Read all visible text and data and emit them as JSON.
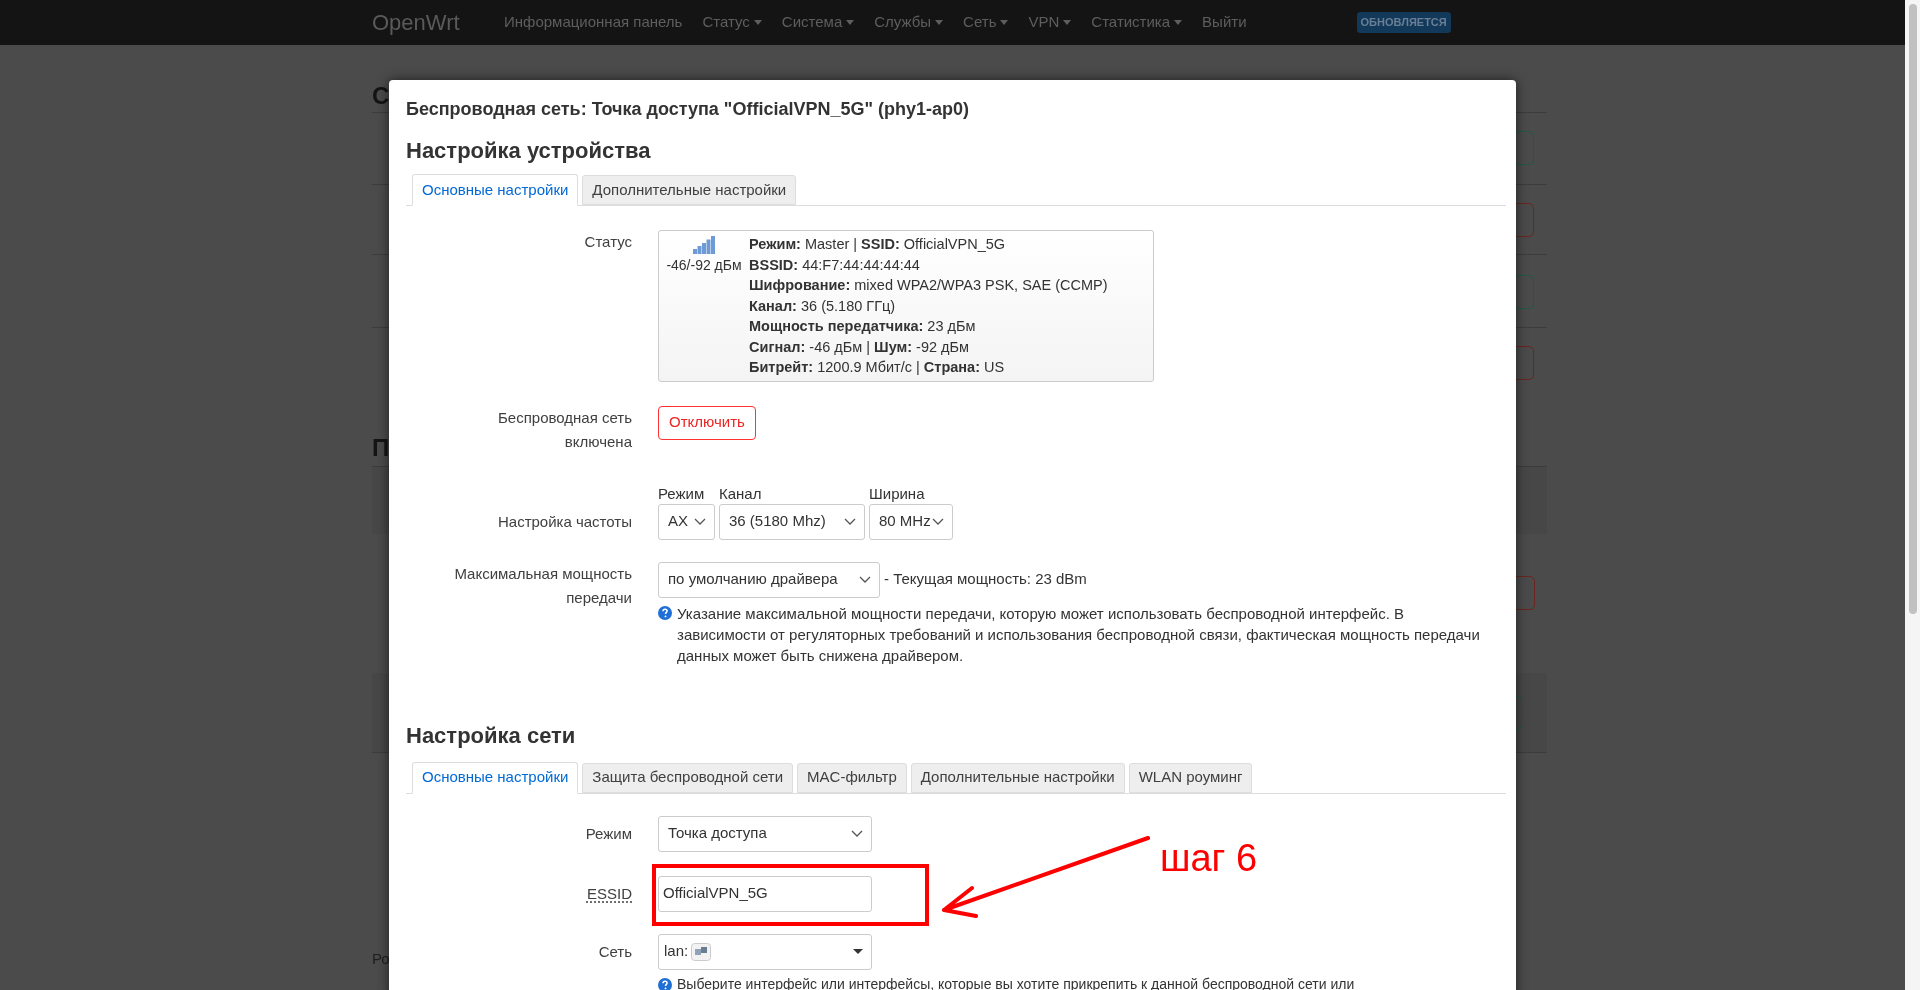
{
  "navbar": {
    "brand": "OpenWrt",
    "menu": [
      {
        "label": "Информационная панель",
        "dropdown": false
      },
      {
        "label": "Статус",
        "dropdown": true
      },
      {
        "label": "Система",
        "dropdown": true
      },
      {
        "label": "Службы",
        "dropdown": true
      },
      {
        "label": "Сеть",
        "dropdown": true
      },
      {
        "label": "VPN",
        "dropdown": true
      },
      {
        "label": "Статистика",
        "dropdown": true
      },
      {
        "label": "Выйти",
        "dropdown": false
      }
    ],
    "badge": "ОБНОВЛЯЕТСЯ"
  },
  "background_page": {
    "headings": [
      "С",
      "П"
    ],
    "footer": "Ро",
    "button_edges": [
      {
        "color": "#1f5a40"
      },
      {
        "color": "#6a2620"
      },
      {
        "color": "#1f5a40"
      },
      {
        "color": "#6a2620"
      },
      {
        "color": "#6a2620"
      },
      {
        "color": "#1f5a40"
      }
    ]
  },
  "modal": {
    "title": "Беспроводная сеть: Точка доступа \"OfficialVPN_5G\" (phy1-ap0)",
    "device_section": {
      "heading": "Настройка устройства",
      "tabs": [
        {
          "label": "Основные настройки",
          "selected": true
        },
        {
          "label": "Дополнительные настройки",
          "selected": false
        }
      ],
      "status": {
        "label": "Статус",
        "signal_reading": "-46/-92 дБм",
        "lines": [
          "**Режим:** Master | **SSID:** OfficialVPN_5G",
          "**BSSID:** 44:F7:44:44:44:44",
          "**Шифрование:** mixed WPA2/WPA3 PSK, SAE (CCMP)",
          "**Канал:** 36 (5.180 ГГц)",
          "**Мощность передатчика:** 23 дБм",
          "**Сигнал:** -46 дБм | **Шум:** -92 дБм",
          "**Битрейт:** 1200.9 Мбит/с | **Страна:** US"
        ]
      },
      "enable": {
        "label": "Беспроводная сеть включена",
        "button": "Отключить"
      },
      "frequency": {
        "label": "Настройка частоты",
        "fields": [
          {
            "label": "Режим",
            "value": "AX"
          },
          {
            "label": "Канал",
            "value": "36 (5180 Mhz)"
          },
          {
            "label": "Ширина",
            "value": "80 MHz"
          }
        ]
      },
      "max_power": {
        "label": "Максимальная мощность передачи",
        "value": "по умолчанию драйвера",
        "current": "- Текущая мощность: 23 dBm",
        "help": "Указание максимальной мощности передачи, которую может использовать беспроводной интерфейс. В зависимости от регуляторных требований и использования беспроводной связи, фактическая мощность передачи данных может быть снижена драйвером."
      }
    },
    "network_section": {
      "heading": "Настройка сети",
      "tabs": [
        {
          "label": "Основные настройки",
          "selected": true
        },
        {
          "label": "Защита беспроводной сети",
          "selected": false
        },
        {
          "label": "MAC-фильтр",
          "selected": false
        },
        {
          "label": "Дополнительные настройки",
          "selected": false
        },
        {
          "label": "WLAN роуминг",
          "selected": false
        }
      ],
      "mode": {
        "label": "Режим",
        "value": "Точка доступа"
      },
      "essid": {
        "label": "ESSID",
        "value": "OfficialVPN_5G"
      },
      "network": {
        "label": "Сеть",
        "value": "lan:",
        "help": "Выберите интерфейс или интерфейсы, которые вы хотите прикрепить к данной беспроводной сети или"
      }
    }
  },
  "annotation": {
    "text": "шаг 6"
  }
}
